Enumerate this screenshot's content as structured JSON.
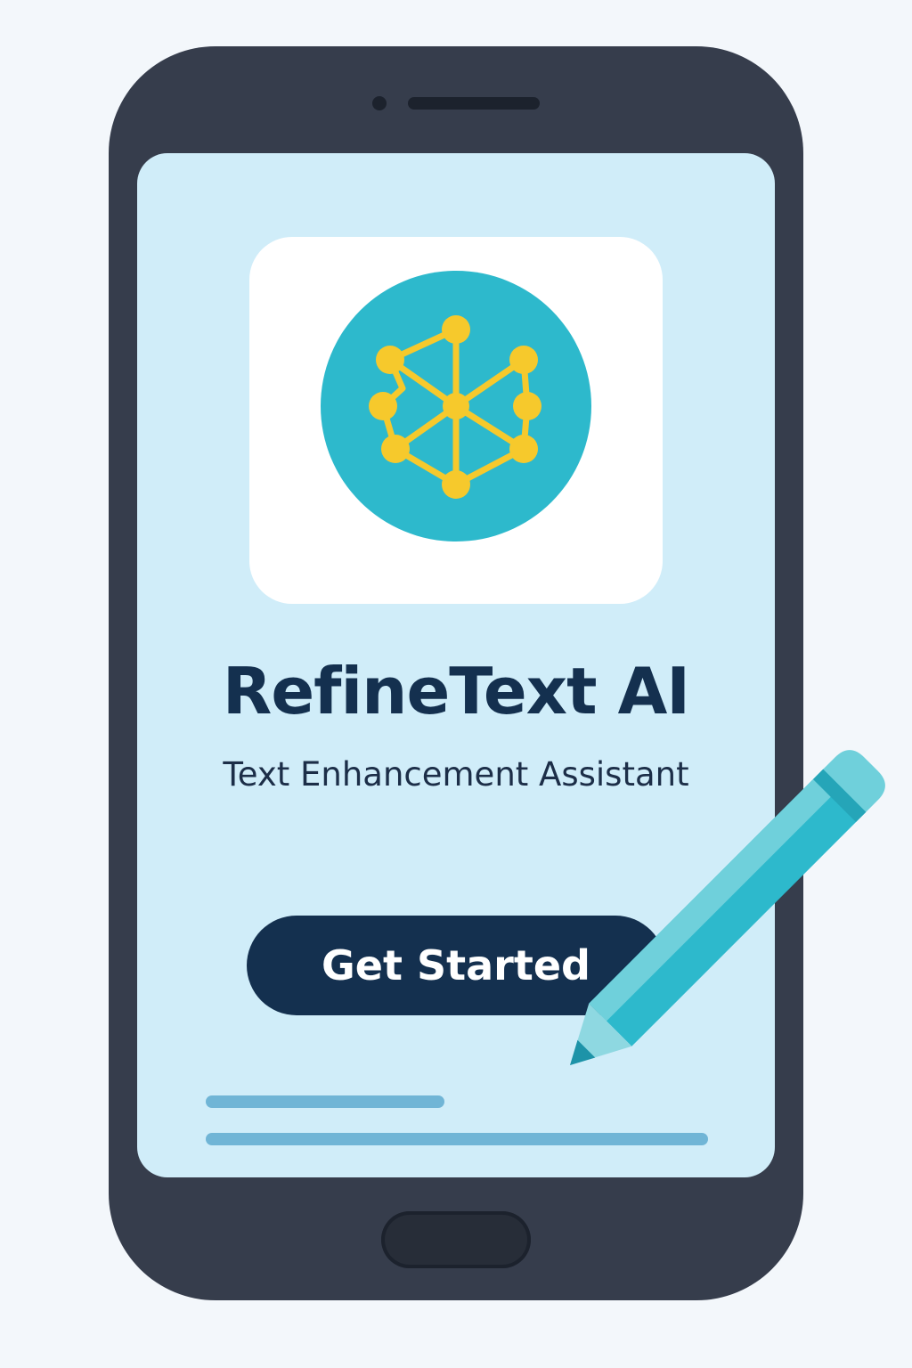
{
  "app": {
    "title": "RefineText AI",
    "subtitle": "Text Enhancement Assistant",
    "cta_label": "Get Started"
  },
  "icons": {
    "logo": "network-nodes-icon",
    "decoration": "pencil-icon"
  },
  "colors": {
    "background": "#f3f7fb",
    "phone_body": "#363d4c",
    "screen": "#d0edf9",
    "logo_circle": "#2db9cc",
    "logo_nodes": "#f6c92c",
    "title_text": "#14304f",
    "button_bg": "#14304f",
    "button_text": "#ffffff",
    "text_lines": "#70b5d6",
    "pencil": "#2db9cc"
  }
}
